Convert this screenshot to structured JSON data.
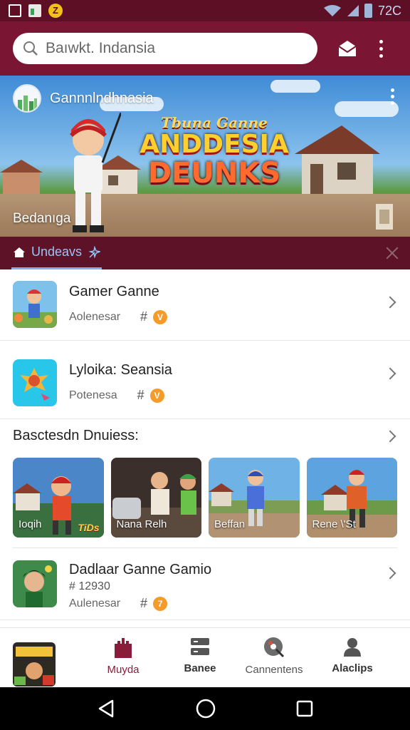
{
  "status_bar": {
    "time": "72C"
  },
  "search": {
    "placeholder": "Baıwkt. Indansia"
  },
  "banner": {
    "channel_name": "Gannnlndhnasia",
    "logo_line1": "Tbuna Ganne",
    "logo_line2": "ANDDESIA",
    "logo_line3": "DEUNKS",
    "caption": "Bedanıga"
  },
  "tab_strip": {
    "active_tab": "Undeavs"
  },
  "list": [
    {
      "title": "Gamer Ganne",
      "subtitle": "Aolenesar",
      "hash": "#",
      "badge": "V"
    },
    {
      "title": "Lyloika: Seansia",
      "subtitle": "Potenesa",
      "hash": "#",
      "badge": "V"
    }
  ],
  "section": {
    "title": "Basctesdn Dnuiess:"
  },
  "carousel": [
    {
      "label": "Ioqih",
      "overlay": "TiDs"
    },
    {
      "label": "Nana Relh"
    },
    {
      "label": "Beffan"
    },
    {
      "label": "Rene \\'St"
    }
  ],
  "item3": {
    "title": "Dadlaar Ganne Gamio",
    "code": "# 12930",
    "subtitle": "Aulenesar",
    "hash": "#",
    "badge": "7"
  },
  "bottom_nav": [
    {
      "label": "Muyda",
      "icon": "castle-icon"
    },
    {
      "label": "Banee",
      "icon": "storage-icon"
    },
    {
      "label": "Cannentens",
      "icon": "disc-icon"
    },
    {
      "label": "Alaclips",
      "icon": "person-icon"
    }
  ],
  "colors": {
    "app_bar": "#7a1533",
    "status_bar": "#5c0f25",
    "tab_strip": "#5e1228",
    "accent": "#8a1c3b",
    "badge": "#f59b2a"
  }
}
